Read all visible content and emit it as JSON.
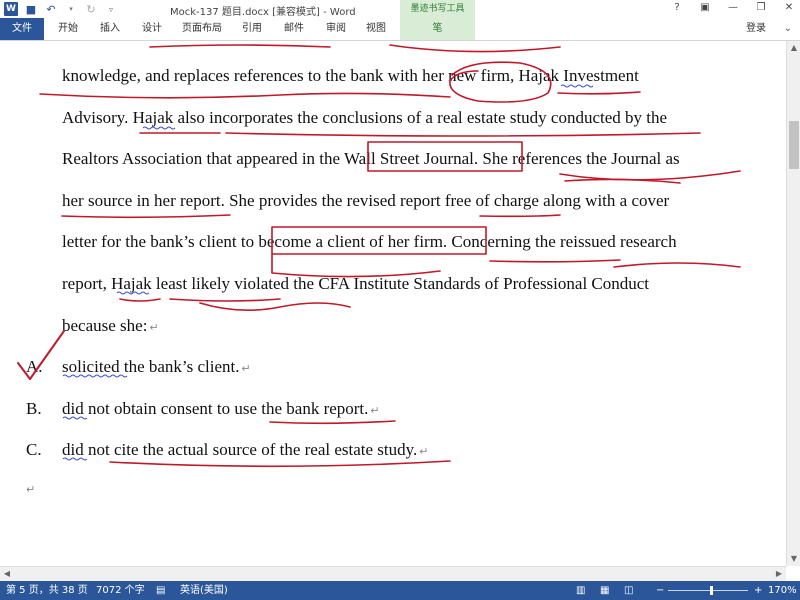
{
  "titlebar": {
    "doc_title": "Mock-137 题目.docx [兼容模式] - Word",
    "ink_tools": "墨迹书写工具",
    "minimize": "—",
    "restore": "❐",
    "close": "✕",
    "help": "?"
  },
  "ribbon": {
    "file": "文件",
    "tabs": [
      "开始",
      "插入",
      "设计",
      "页面布局",
      "引用",
      "邮件",
      "审阅",
      "视图"
    ],
    "pen": "笔",
    "login": "登录"
  },
  "document": {
    "lines": [
      "knowledge, and replaces references to the bank with her new firm, Hajak Investment",
      "Advisory. Hajak also incorporates the conclusions of a real estate study conducted by the",
      "Realtors Association that appeared in the Wall Street Journal. She references the Journal as",
      "her source in her report. She provides the revised report free of charge along with a cover",
      "letter for the bank’s client to become a client of her firm. Concerning the reissued research",
      "report, Hajak least likely violated the CFA Institute Standards of Professional Conduct",
      "because she:"
    ],
    "options": [
      {
        "label": "A.",
        "text": "solicited the bank’s client."
      },
      {
        "label": "B.",
        "text": "did not obtain consent to use the bank report."
      },
      {
        "label": "C.",
        "text": "did not cite the actual source of the real estate study."
      }
    ],
    "para_mark": "↵"
  },
  "statusbar": {
    "page": "第 5 页，共 38 页",
    "words": "7072 个字",
    "language": "英语(美国)",
    "zoom": "170%",
    "zoom_minus": "−",
    "zoom_plus": "+"
  },
  "colors": {
    "accent": "#2b579a",
    "ink": "#c0192a",
    "ink_tools_bg": "#d8ecd6"
  }
}
